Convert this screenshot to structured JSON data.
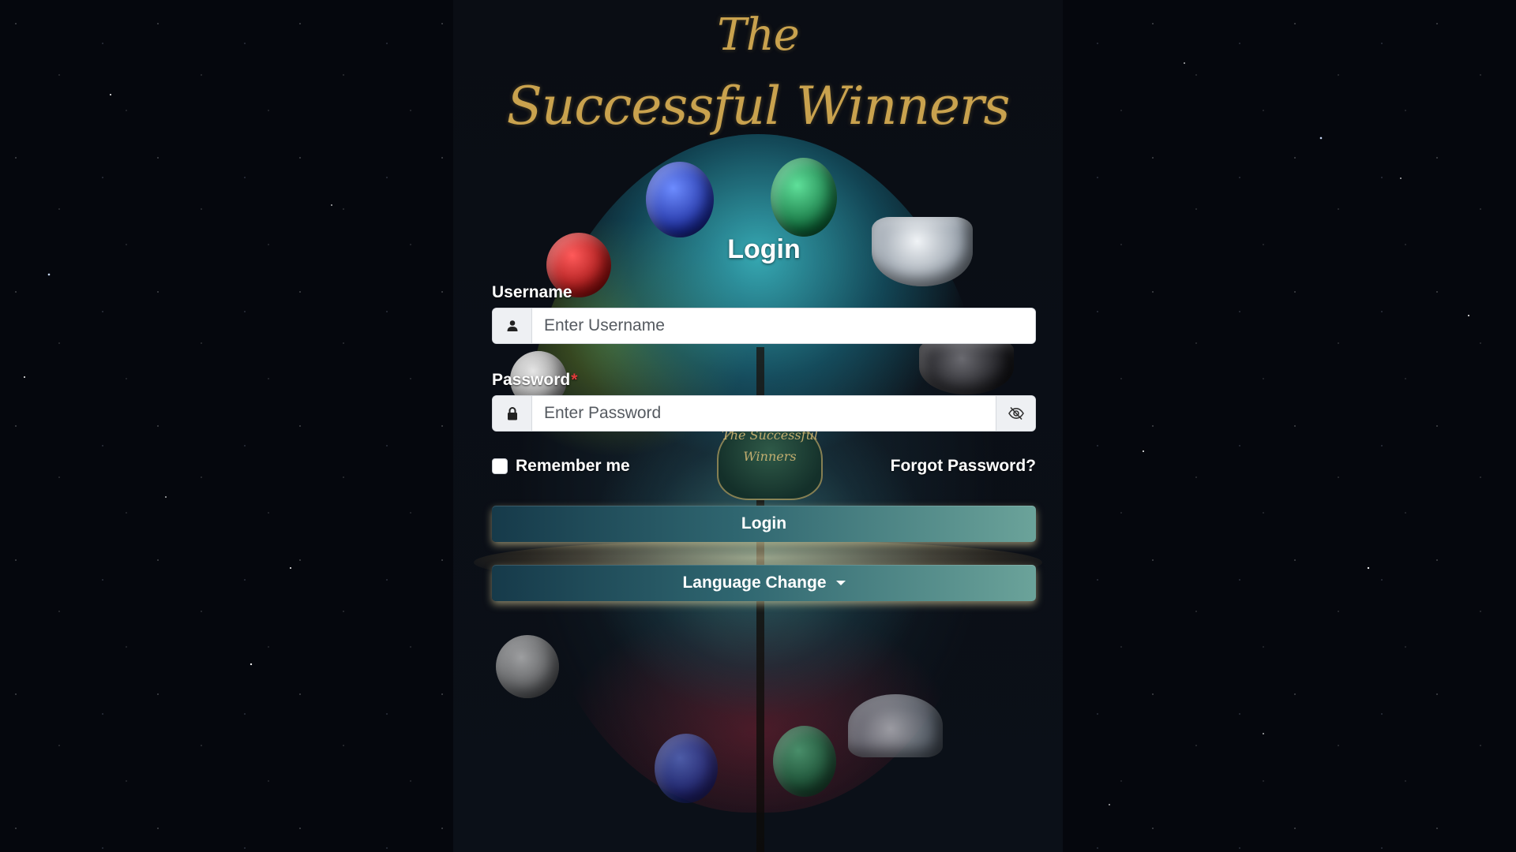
{
  "brand": {
    "line1": "The",
    "line2": "Successful Winners",
    "emblem_text": "The Successful Winners"
  },
  "login_form": {
    "title": "Login",
    "username": {
      "label": "Username",
      "placeholder": "Enter Username",
      "value": "",
      "icon": "user-icon"
    },
    "password": {
      "label": "Password",
      "required_mark": "*",
      "placeholder": "Enter Password",
      "value": "",
      "icon": "lock-icon",
      "toggle_icon": "eye-slash-icon"
    },
    "remember_me": {
      "label": "Remember me",
      "checked": false
    },
    "forgot_password": "Forgot Password?",
    "login_button": "Login",
    "language_button": "Language Change"
  },
  "colors": {
    "brand_gold": "#c9a24e",
    "button_gradient_start": "#163a4a",
    "button_gradient_end": "#6ba39a",
    "required": "#e03b3b",
    "page_background": "#05070d"
  }
}
